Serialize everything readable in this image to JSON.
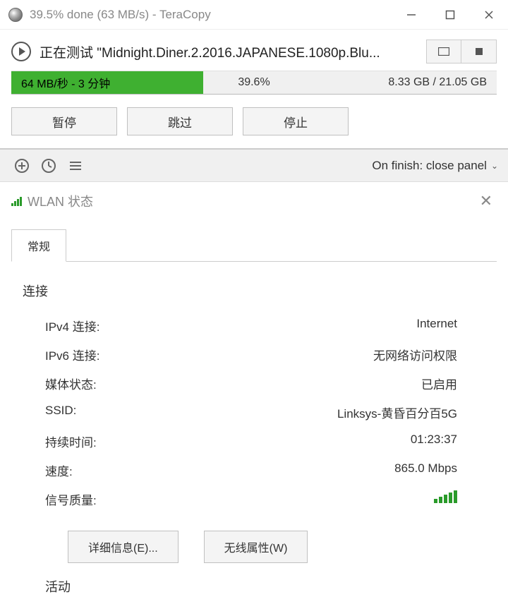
{
  "titlebar": {
    "text": "39.5% done (63 MB/s) - TeraCopy"
  },
  "header": {
    "status_prefix": "正在测试 ",
    "filename": "\"Midnight.Diner.2.2016.JAPANESE.1080p.Blu..."
  },
  "progress": {
    "speed_eta": "64 MB/秒 - 3 分钟",
    "percent": "39.6%",
    "size": "8.33 GB / 21.05 GB"
  },
  "actions": {
    "pause": "暂停",
    "skip": "跳过",
    "stop": "停止"
  },
  "toolbar": {
    "onfinish": "On finish: close panel"
  },
  "wlan": {
    "title": "WLAN 状态",
    "tab_general": "常规",
    "section_connection": "连接",
    "rows": {
      "ipv4_key": "IPv4 连接:",
      "ipv4_val": "Internet",
      "ipv6_key": "IPv6 连接:",
      "ipv6_val": "无网络访问权限",
      "media_key": "媒体状态:",
      "media_val": "已启用",
      "ssid_key": "SSID:",
      "ssid_val": "Linksys-黄昏百分百5G",
      "duration_key": "持续时间:",
      "duration_val": "01:23:37",
      "speed_key": "速度:",
      "speed_val": "865.0 Mbps",
      "quality_key": "信号质量:"
    },
    "buttons": {
      "details": "详细信息(E)...",
      "wireless_props": "无线属性(W)"
    },
    "section_activity": "活动"
  }
}
